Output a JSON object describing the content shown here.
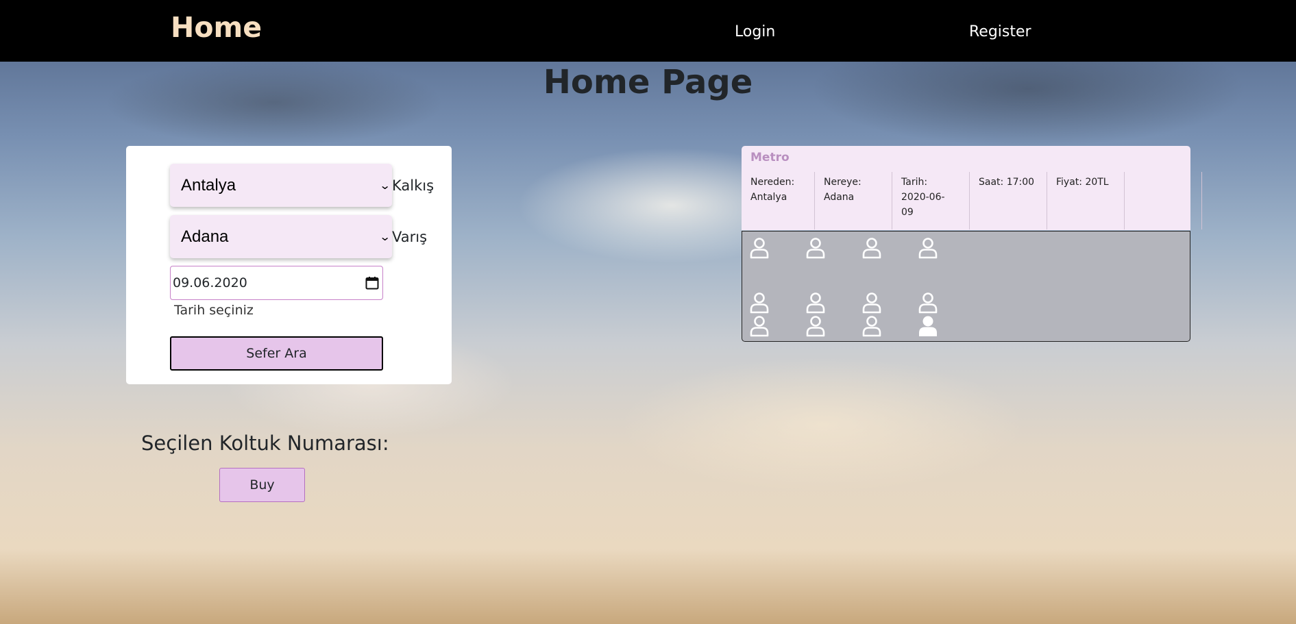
{
  "nav": {
    "brand": "Home",
    "login": "Login",
    "register": "Register"
  },
  "page": {
    "title": "Home Page"
  },
  "search": {
    "from_value": "Antalya",
    "from_label": "Kalkış",
    "to_value": "Adana",
    "to_label": "Varış",
    "date_value": "09.06.2020",
    "date_hint": "Tarih seçiniz",
    "search_button": "Sefer Ara"
  },
  "selection": {
    "label": "Seçilen Koltuk Numarası:",
    "buy_button": "Buy"
  },
  "trip": {
    "company": "Metro",
    "columns": [
      {
        "line1": "Nereden:",
        "line2": "Antalya",
        "line3": ""
      },
      {
        "line1": "Nereye:",
        "line2": "Adana",
        "line3": ""
      },
      {
        "line1": "Tarih:",
        "line2": "2020-06-",
        "line3": "09"
      },
      {
        "line1": "Saat: 17:00",
        "line2": "",
        "line3": ""
      },
      {
        "line1": "Fiyat: 20TL",
        "line2": "",
        "line3": ""
      },
      {
        "line1": "",
        "line2": "",
        "line3": ""
      }
    ]
  },
  "seats": {
    "rows": [
      [
        "empty",
        "empty",
        "empty",
        "empty"
      ],
      [
        "empty",
        "empty",
        "empty",
        "empty"
      ],
      [
        "empty",
        "empty",
        "empty",
        "taken"
      ]
    ]
  },
  "colors": {
    "navbar": "#000000",
    "brand": "#f7dfc1",
    "select_bg": "#f5e8f6",
    "button_bg": "#e6c5ea",
    "company": "#b98fc0",
    "seat_panel": "#b4b5bc"
  }
}
